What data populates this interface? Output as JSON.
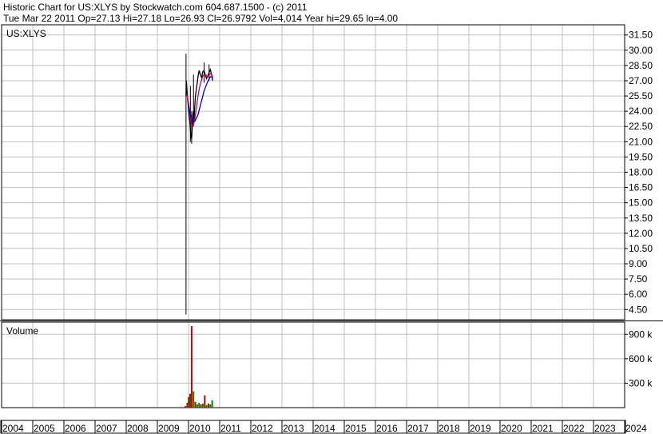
{
  "header": {
    "line1": "Historic Chart for US:XLYS by Stockwatch.com 604.687.1500 - (c) 2011",
    "line2": "Tue Mar 22 2011   Op=27.13   Hi=27.18   Lo=26.93   Cl=26.9792   Vol=4,014   Year hi=29.65   lo=4.00"
  },
  "chart_data": {
    "type": "line",
    "symbol": "US:XLYS",
    "price_panel": {
      "label": "US:XLYS",
      "y_ticks": [
        "31.50",
        "30.00",
        "28.50",
        "27.00",
        "25.50",
        "24.00",
        "22.50",
        "21.00",
        "19.50",
        "18.00",
        "16.50",
        "15.00",
        "13.50",
        "12.00",
        "10.50",
        "9.00",
        "7.50",
        "6.00",
        "4.50"
      ],
      "ylim": [
        3.5,
        32.5
      ],
      "series": [
        {
          "name": "",
          "color": "#000000",
          "x": [
            2009.92,
            2009.93,
            2009.95,
            2009.97,
            2009.99,
            2010.01,
            2010.04,
            2010.06,
            2010.08,
            2010.1,
            2010.12,
            2010.14,
            2010.16,
            2010.18,
            2010.2,
            2010.22,
            2010.25,
            2010.28,
            2010.31,
            2010.34,
            2010.38,
            2010.42,
            2010.46,
            2010.5,
            2010.54,
            2010.58,
            2010.62,
            2010.66,
            2010.7,
            2010.74,
            2010.78
          ],
          "values": [
            25.5,
            27.0,
            26.0,
            25.2,
            24.6,
            23.8,
            23.0,
            22.2,
            21.5,
            21.3,
            22.4,
            23.6,
            24.0,
            23.2,
            24.5,
            25.4,
            26.2,
            26.8,
            27.5,
            28.0,
            27.6,
            27.3,
            27.9,
            28.0,
            27.5,
            27.2,
            27.5,
            27.8,
            28.1,
            27.6,
            27.0
          ]
        },
        {
          "name": "",
          "color": "#cc0066",
          "x": [
            2009.95,
            2010.0,
            2010.05,
            2010.1,
            2010.15,
            2010.2,
            2010.25,
            2010.3,
            2010.35,
            2010.4,
            2010.45,
            2010.5,
            2010.55,
            2010.6,
            2010.65,
            2010.7,
            2010.75,
            2010.78
          ],
          "values": [
            25.6,
            24.8,
            23.5,
            22.6,
            22.6,
            23.2,
            24.3,
            25.4,
            26.3,
            26.9,
            27.4,
            27.6,
            27.6,
            27.4,
            27.5,
            27.7,
            27.6,
            27.3
          ]
        },
        {
          "name": "",
          "color": "#0000cc",
          "x": [
            2010.0,
            2010.1,
            2010.2,
            2010.3,
            2010.4,
            2010.5,
            2010.6,
            2010.7,
            2010.78
          ],
          "values": [
            24.5,
            23.2,
            23.0,
            23.6,
            24.8,
            26.0,
            26.8,
            27.4,
            27.3
          ]
        }
      ],
      "wicks": [
        {
          "x": 2009.92,
          "low": 4.0,
          "high": 29.65
        },
        {
          "x": 2010.06,
          "low": 21.0,
          "high": 26.5
        },
        {
          "x": 2010.1,
          "low": 20.8,
          "high": 24.0
        },
        {
          "x": 2010.16,
          "low": 22.5,
          "high": 27.6
        },
        {
          "x": 2010.5,
          "low": 26.8,
          "high": 28.8
        },
        {
          "x": 2010.66,
          "low": 27.0,
          "high": 28.6
        }
      ]
    },
    "volume_panel": {
      "label": "Volume",
      "y_ticks": [
        "900 k",
        "600 k",
        "300 k"
      ],
      "ylim": [
        0,
        1050000
      ],
      "bars": [
        {
          "x": 2009.9,
          "value": 20000,
          "color": "#cc0000"
        },
        {
          "x": 2009.96,
          "value": 60000,
          "color": "#cc0000"
        },
        {
          "x": 2010.0,
          "value": 130000,
          "color": "#008800"
        },
        {
          "x": 2010.05,
          "value": 170000,
          "color": "#cc0000"
        },
        {
          "x": 2010.1,
          "value": 1000000,
          "color": "#cc0000"
        },
        {
          "x": 2010.16,
          "value": 200000,
          "color": "#008800"
        },
        {
          "x": 2010.22,
          "value": 70000,
          "color": "#cc0000"
        },
        {
          "x": 2010.28,
          "value": 40000,
          "color": "#008800"
        },
        {
          "x": 2010.34,
          "value": 60000,
          "color": "#008800"
        },
        {
          "x": 2010.4,
          "value": 40000,
          "color": "#cc0000"
        },
        {
          "x": 2010.46,
          "value": 50000,
          "color": "#008800"
        },
        {
          "x": 2010.52,
          "value": 150000,
          "color": "#cc0000"
        },
        {
          "x": 2010.58,
          "value": 30000,
          "color": "#008800"
        },
        {
          "x": 2010.64,
          "value": 50000,
          "color": "#cc0000"
        },
        {
          "x": 2010.7,
          "value": 40000,
          "color": "#008800"
        },
        {
          "x": 2010.76,
          "value": 90000,
          "color": "#008800"
        }
      ]
    },
    "x_axis": {
      "ticks": [
        "2004",
        "2005",
        "2006",
        "2007",
        "2008",
        "2009",
        "2010",
        "2011",
        "2012",
        "2013",
        "2014",
        "2015",
        "2016",
        "2017",
        "2018",
        "2019",
        "2020",
        "2021",
        "2022",
        "2023",
        "2024"
      ],
      "xlim": [
        2004,
        2024
      ]
    },
    "grid": true,
    "grid_color": "#c0c0c0"
  }
}
